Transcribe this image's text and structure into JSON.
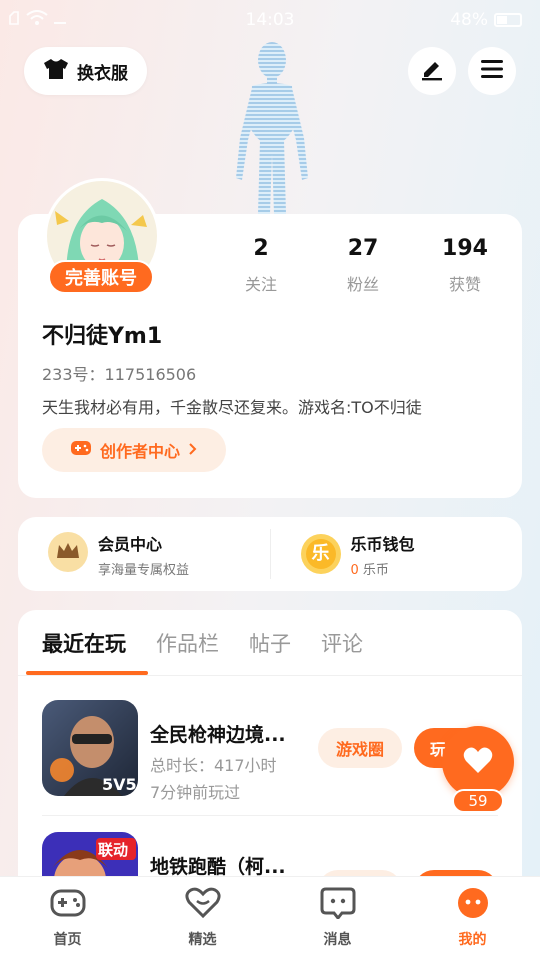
{
  "status_bar": {
    "time": "14:03",
    "battery": "48%"
  },
  "top_bar": {
    "wardrobe_label": "换衣服"
  },
  "profile": {
    "badge": "完善账号",
    "username": "不归徒Ym1",
    "uid_label": "233号：",
    "uid": "117516506",
    "bio": "天生我材必有用，千金散尽还复来。游戏名:TO不归徒",
    "creator_center": "创作者中心",
    "stats": [
      {
        "value": "2",
        "label": "关注"
      },
      {
        "value": "27",
        "label": "粉丝"
      },
      {
        "value": "194",
        "label": "获赞"
      }
    ]
  },
  "wallet": {
    "vip": {
      "title": "会员中心",
      "sub": "享海量专属权益"
    },
    "coins": {
      "title": "乐币钱包",
      "amount": "0",
      "unit": " 乐币",
      "icon_char": "乐"
    }
  },
  "tabs": [
    "最近在玩",
    "作品栏",
    "帖子",
    "评论"
  ],
  "games": [
    {
      "name": "全民枪神边境...",
      "meta1": "总时长：417小时",
      "meta2": "7分钟前玩过",
      "circle": "游戏圈",
      "play": "玩"
    },
    {
      "name": "地铁跑酷（柯...",
      "meta1": "",
      "meta2": "",
      "circle": "",
      "play": ""
    }
  ],
  "fab": {
    "count": "59"
  },
  "bottom_nav": [
    {
      "label": "首页"
    },
    {
      "label": "精选"
    },
    {
      "label": "消息"
    },
    {
      "label": "我的"
    }
  ],
  "colors": {
    "accent": "#ff6a1f",
    "accent_light": "#fdeee3"
  }
}
